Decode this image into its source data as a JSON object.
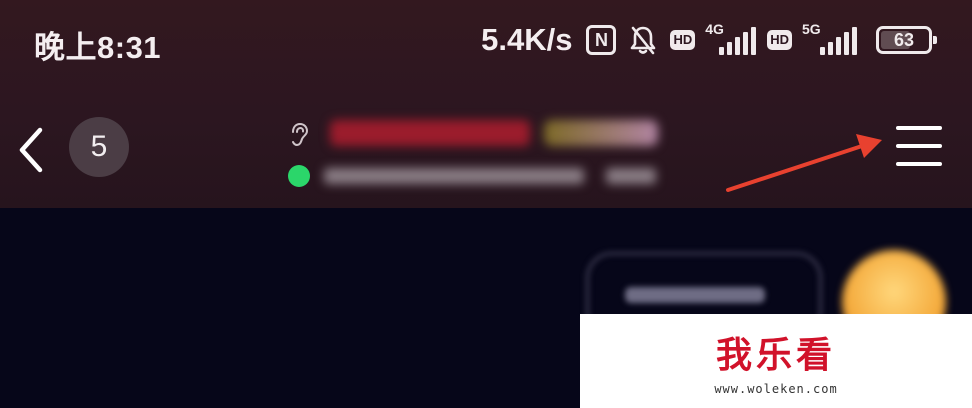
{
  "status_bar": {
    "time": "晚上8:31",
    "net_speed": "5.4K/s",
    "nfc": "N",
    "hd_label": "HD",
    "sim1_network": "4G",
    "sim2_network": "5G",
    "battery": "63",
    "battery_level": 0.63,
    "icons": [
      "nfc-icon",
      "bell-off-icon",
      "hd-badge",
      "signal-icon",
      "battery-icon"
    ]
  },
  "nav_bar": {
    "unread_count": "5",
    "icons": [
      "chevron-left-icon",
      "ear-icon",
      "online-dot",
      "menu-icon"
    ]
  },
  "colors": {
    "header_bg": "#2c1620",
    "body_bg": "#060619",
    "online": "#2bd66a",
    "annotation_arrow": "#e8412f",
    "watermark_logo": "#d1122a"
  },
  "watermark": {
    "logo": "我乐看",
    "url": "www.woleken.com"
  }
}
